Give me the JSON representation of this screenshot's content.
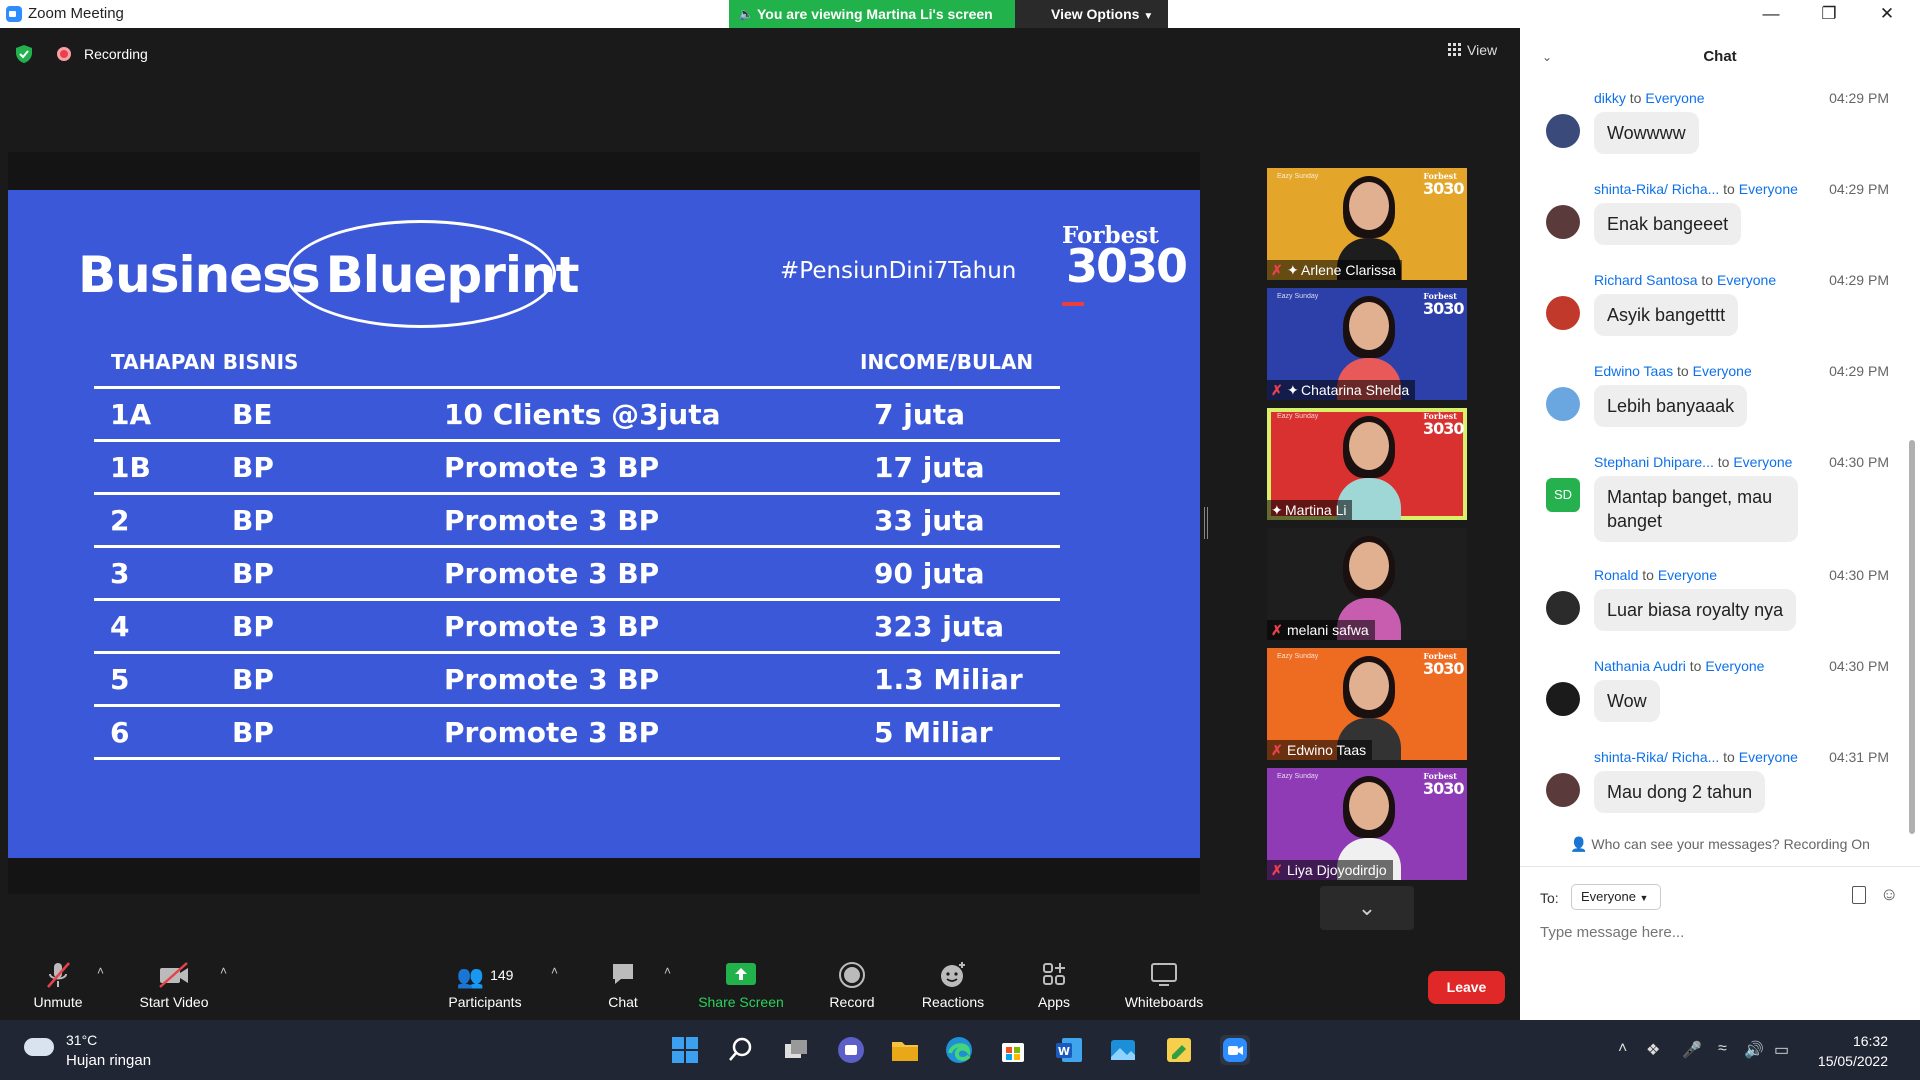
{
  "window": {
    "title": "Zoom Meeting",
    "viewing_banner": "You are viewing Martina Li's screen",
    "view_options": "View Options"
  },
  "topbar": {
    "recording_label": "Recording",
    "view_label": "View"
  },
  "slide": {
    "title_left": "Business",
    "title_right": "Blueprint",
    "hashtag": "#PensiunDini7Tahun",
    "brand": "Forbest",
    "brand_number": "3030",
    "header_stage": "TAHAPAN BISNIS",
    "header_income": "INCOME/BULAN",
    "rows": [
      {
        "stage": "1A",
        "code": "BE",
        "activity": "10 Clients @3juta",
        "income": "7 juta"
      },
      {
        "stage": "1B",
        "code": "BP",
        "activity": "Promote 3 BP",
        "income": "17 juta"
      },
      {
        "stage": "2",
        "code": "BP",
        "activity": "Promote 3 BP",
        "income": "33 juta"
      },
      {
        "stage": "3",
        "code": "BP",
        "activity": "Promote 3 BP",
        "income": "90 juta"
      },
      {
        "stage": "4",
        "code": "BP",
        "activity": "Promote 3 BP",
        "income": "323 juta"
      },
      {
        "stage": "5",
        "code": "BP",
        "activity": "Promote 3 BP",
        "income": "1.3 Miliar"
      },
      {
        "stage": "6",
        "code": "BP",
        "activity": "Promote 3 BP",
        "income": "5 Miliar"
      }
    ]
  },
  "tile_brand": {
    "ez": "Eazy Sunday",
    "fb": "Forbest",
    "num": "3030"
  },
  "participants": [
    {
      "name": "Arlene Clarissa",
      "muted": true,
      "pinned": true,
      "bg": "#e3a62b",
      "shirt": "#1d1d1d"
    },
    {
      "name": "Chatarina Shelda",
      "muted": true,
      "pinned": true,
      "bg": "#2d3fa8",
      "shirt": "#e85a5a"
    },
    {
      "name": "Martina Li",
      "muted": false,
      "pinned": true,
      "bg": "#d93030",
      "shirt": "#9fd6d6"
    },
    {
      "name": "melani safwa",
      "muted": true,
      "pinned": false,
      "bg": "#1e1e1e",
      "shirt": "#c85db0"
    },
    {
      "name": "Edwino Taas",
      "muted": true,
      "pinned": false,
      "bg": "#ee6b22",
      "shirt": "#333333"
    },
    {
      "name": "Liya Djoyodirdjo",
      "muted": true,
      "pinned": false,
      "bg": "#8e3bb5",
      "shirt": "#f0f0f0"
    }
  ],
  "toolbar": {
    "unmute": "Unmute",
    "start_video": "Start Video",
    "participants_count": "149",
    "participants": "Participants",
    "chat": "Chat",
    "share_screen": "Share Screen",
    "record": "Record",
    "reactions": "Reactions",
    "apps": "Apps",
    "whiteboards": "Whiteboards",
    "leave": "Leave"
  },
  "chat": {
    "title": "Chat",
    "to_word": "to",
    "messages": [
      {
        "sender": "dikky",
        "recipient": "Everyone",
        "time": "04:29 PM",
        "text": "Wowwww",
        "avatar_color": "#3a4a7a"
      },
      {
        "sender": "shinta-Rika/ Richa...",
        "recipient": "Everyone",
        "time": "04:29 PM",
        "text": "Enak bangeeet",
        "avatar_color": "#5a3a3a"
      },
      {
        "sender": "Richard Santosa",
        "recipient": "Everyone",
        "time": "04:29 PM",
        "text": "Asyik bangetttt",
        "avatar_color": "#c0392b"
      },
      {
        "sender": "Edwino Taas",
        "recipient": "Everyone",
        "time": "04:29 PM",
        "text": "Lebih banyaaak",
        "avatar_color": "#6aa7e0"
      },
      {
        "sender": "Stephani Dhipare...",
        "recipient": "Everyone",
        "time": "04:30 PM",
        "text": "Mantap banget, mau banget",
        "avatar_color": "#25b24e",
        "initials": "SD"
      },
      {
        "sender": "Ronald",
        "recipient": "Everyone",
        "time": "04:30 PM",
        "text": "Luar biasa royalty nya",
        "avatar_color": "#2b2b2b"
      },
      {
        "sender": "Nathania Audri",
        "recipient": "Everyone",
        "time": "04:30 PM",
        "text": "Wow",
        "avatar_color": "#1b1b1b"
      },
      {
        "sender": "shinta-Rika/ Richa...",
        "recipient": "Everyone",
        "time": "04:31 PM",
        "text": "Mau dong 2 tahun",
        "avatar_color": "#5a3a3a"
      }
    ],
    "notice": "Who can see your messages? Recording On",
    "to_label": "To:",
    "to_value": "Everyone",
    "placeholder": "Type message here..."
  },
  "taskbar": {
    "temp": "31°C",
    "weather": "Hujan ringan",
    "time": "16:32",
    "date": "15/05/2022"
  }
}
